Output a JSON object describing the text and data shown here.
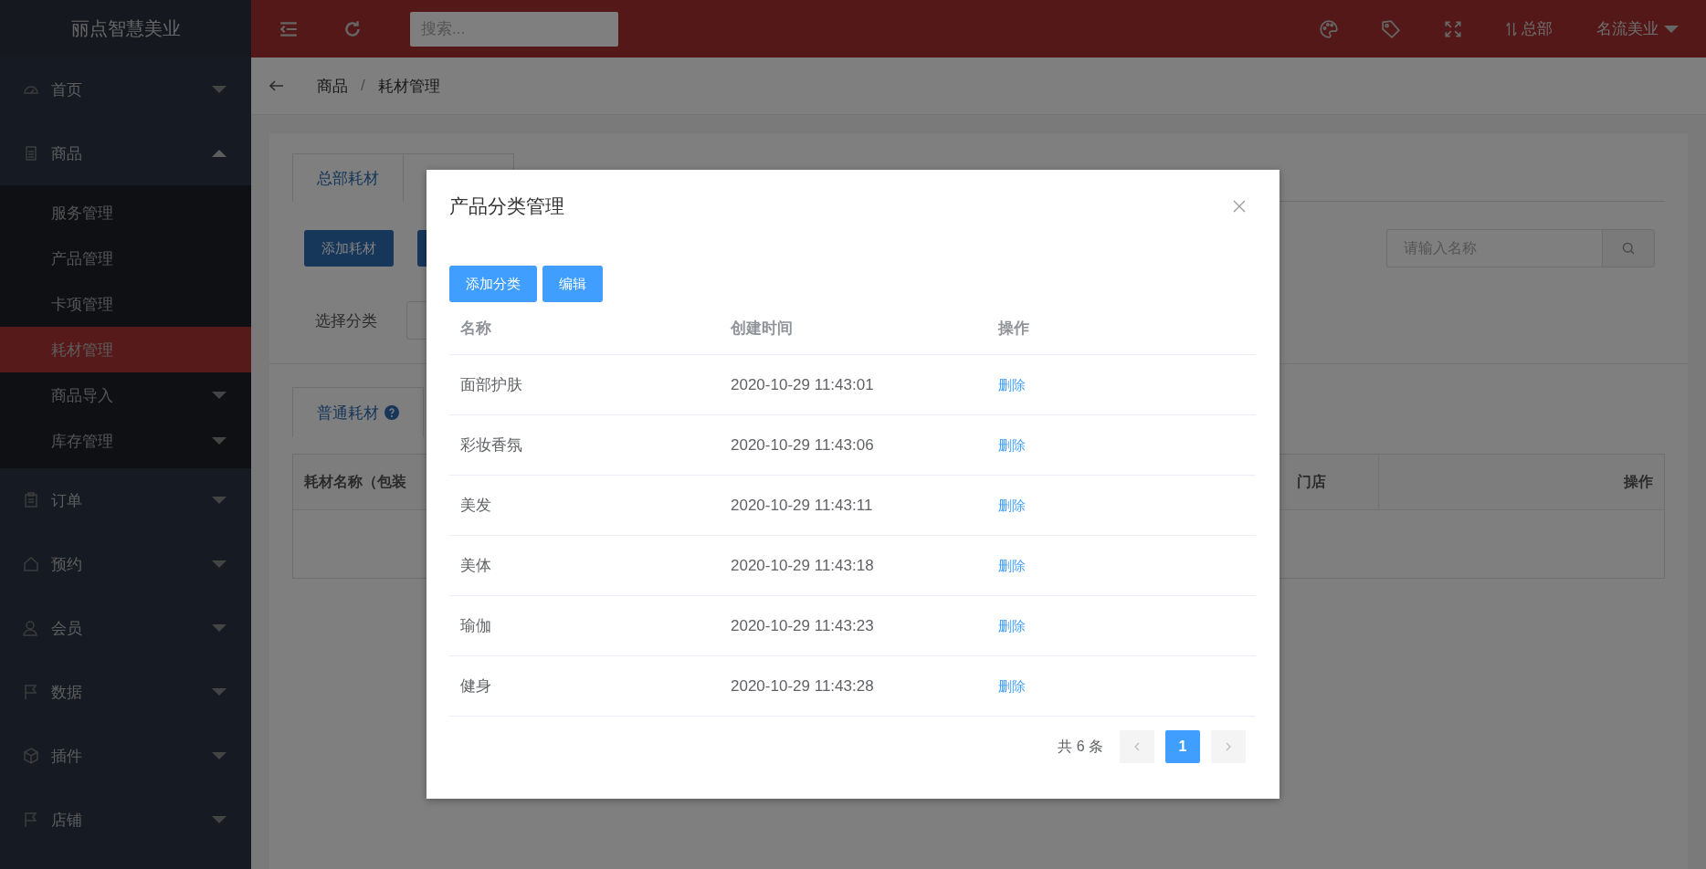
{
  "app_title": "丽点智慧美业",
  "topbar": {
    "search": {
      "placeholder": "搜索..."
    },
    "branch": "总部",
    "user": "名流美业"
  },
  "sidebar": {
    "items": [
      {
        "label": "首页",
        "kind": "dashboard",
        "expanded": false
      },
      {
        "label": "商品",
        "kind": "document",
        "expanded": true,
        "children": [
          {
            "label": "服务管理",
            "selected": false
          },
          {
            "label": "产品管理",
            "selected": false
          },
          {
            "label": "卡项管理",
            "selected": false
          },
          {
            "label": "耗材管理",
            "selected": true
          },
          {
            "label": "商品导入",
            "selected": false,
            "expanded": false
          },
          {
            "label": "库存管理",
            "selected": false,
            "expanded": false
          }
        ]
      },
      {
        "label": "订单",
        "kind": "clipboard",
        "expanded": false
      },
      {
        "label": "预约",
        "kind": "home",
        "expanded": false
      },
      {
        "label": "会员",
        "kind": "user",
        "expanded": false
      },
      {
        "label": "数据",
        "kind": "flag",
        "expanded": false
      },
      {
        "label": "插件",
        "kind": "cube",
        "expanded": false
      },
      {
        "label": "店铺",
        "kind": "flag",
        "expanded": false
      }
    ]
  },
  "breadcrumb": [
    "商品",
    "耗材管理"
  ],
  "breadcrumb_separator": "/",
  "page": {
    "tabs": [
      {
        "label": "总部耗材",
        "selected": true
      }
    ],
    "add_button": "添加耗材",
    "filter_label": "选择分类",
    "search": {
      "placeholder": "请输入名称"
    },
    "sub_tabs": [
      {
        "label": "普通耗材",
        "selected": true
      }
    ],
    "table": {
      "columns": [
        "耗材名称（包装",
        "门店",
        "操作"
      ]
    }
  },
  "modal": {
    "title": "产品分类管理",
    "buttons": [
      "添加分类",
      "编辑"
    ],
    "table": {
      "columns": [
        "名称",
        "创建时间",
        "操作"
      ],
      "rows": [
        {
          "name": "面部护肤",
          "created": "2020-10-29 11:43:01",
          "action": "删除"
        },
        {
          "name": "彩妆香氛",
          "created": "2020-10-29 11:43:06",
          "action": "删除"
        },
        {
          "name": "美发",
          "created": "2020-10-29 11:43:11",
          "action": "删除"
        },
        {
          "name": "美体",
          "created": "2020-10-29 11:43:18",
          "action": "删除"
        },
        {
          "name": "瑜伽",
          "created": "2020-10-29 11:43:23",
          "action": "删除"
        },
        {
          "name": "健身",
          "created": "2020-10-29 11:43:28",
          "action": "删除"
        }
      ]
    },
    "pagination": {
      "total": "共 6 条",
      "pages": [
        {
          "label": "1",
          "selected": true
        }
      ]
    }
  }
}
